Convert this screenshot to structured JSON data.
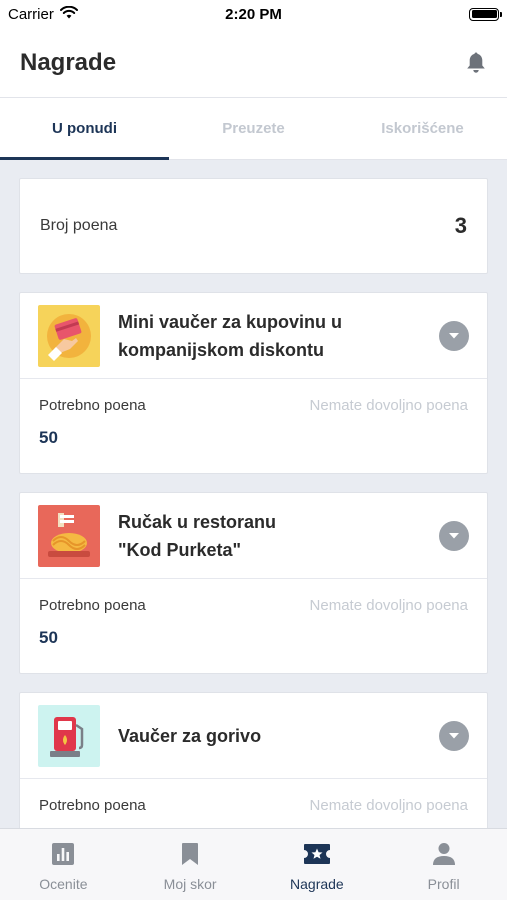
{
  "status_bar": {
    "carrier": "Carrier",
    "time": "2:20 PM"
  },
  "header": {
    "title": "Nagrade"
  },
  "tabs": [
    {
      "label": "U ponudi",
      "active": true
    },
    {
      "label": "Preuzete",
      "active": false
    },
    {
      "label": "Iskorišćene",
      "active": false
    }
  ],
  "points": {
    "label": "Broj poena",
    "value": "3"
  },
  "rewards": [
    {
      "title_line1": "Mini vaučer za kupovinu u",
      "title_line2": "kompanijskom diskontu",
      "required_label": "Potrebno poena",
      "status": "Nemate dovoljno poena",
      "required_value": "50",
      "icon": "card-payment-icon",
      "icon_bg": "#f6d35a"
    },
    {
      "title_line1": "Ručak u restoranu",
      "title_line2": "\"Kod Purketa\"",
      "required_label": "Potrebno poena",
      "status": "Nemate dovoljno poena",
      "required_value": "50",
      "icon": "spaghetti-icon",
      "icon_bg": "#e8685a"
    },
    {
      "title_line1": "Vaučer za gorivo",
      "required_label": "Potrebno poena",
      "status": "Nemate dovoljno poena",
      "icon": "fuel-pump-icon",
      "icon_bg": "#cdf3f0"
    }
  ],
  "tab_bar": [
    {
      "label": "Ocenite",
      "icon": "chart-icon",
      "active": false
    },
    {
      "label": "Moj skor",
      "icon": "bookmark-icon",
      "active": false
    },
    {
      "label": "Nagrade",
      "icon": "ticket-icon",
      "active": true
    },
    {
      "label": "Profil",
      "icon": "user-icon",
      "active": false
    }
  ],
  "colors": {
    "accent": "#1d3557",
    "muted": "#c3c8d0",
    "background": "#e9ecf2"
  }
}
